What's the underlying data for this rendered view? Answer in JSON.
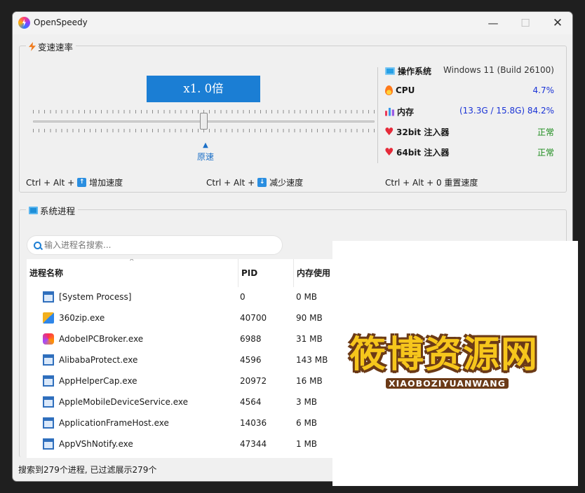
{
  "window": {
    "title": "OpenSpeedy",
    "controls": {
      "minimize": "—",
      "maximize": "☐",
      "close": "✕"
    }
  },
  "speed": {
    "group_title": "变速速率",
    "display": "x1. 0倍",
    "slider_value": 1.0,
    "reset_label": "原速",
    "shortcuts": {
      "increase_combo": "Ctrl + Alt +",
      "increase_key": "↑",
      "increase_label": "增加速度",
      "decrease_combo": "Ctrl + Alt +",
      "decrease_key": "↓",
      "decrease_label": "减少速度",
      "reset_text": "Ctrl + Alt + 0 重置速度"
    }
  },
  "sysinfo": {
    "os_label": "操作系统",
    "os_value": "Windows 11 (Build 26100)",
    "cpu_label": "CPU",
    "cpu_value": "4.7%",
    "mem_label": "内存",
    "mem_value": "(13.3G / 15.8G) 84.2%",
    "inj32_label": "32bit 注入器",
    "inj32_value": "正常",
    "inj64_label": "64bit 注入器",
    "inj64_value": "正常",
    "colors": {
      "value_blue": "#1a33d6",
      "ok_green": "#1a8a1a",
      "accent": "#1b7ed4"
    }
  },
  "processes": {
    "group_title": "系统进程",
    "search_placeholder": "输入进程名搜索...",
    "sort_indicator": "^",
    "columns": {
      "name": "进程名称",
      "pid": "PID",
      "mem": "内存使用"
    },
    "rows": [
      {
        "name": "[System Process]",
        "pid": "0",
        "mem": "0 MB",
        "icon": "window-icon"
      },
      {
        "name": "360zip.exe",
        "pid": "40700",
        "mem": "90 MB",
        "icon": "zip-icon"
      },
      {
        "name": "AdobeIPCBroker.exe",
        "pid": "6988",
        "mem": "31 MB",
        "icon": "adobe-icon"
      },
      {
        "name": "AlibabaProtect.exe",
        "pid": "4596",
        "mem": "143 MB",
        "icon": "window-icon"
      },
      {
        "name": "AppHelperCap.exe",
        "pid": "20972",
        "mem": "16 MB",
        "icon": "window-icon"
      },
      {
        "name": "AppleMobileDeviceService.exe",
        "pid": "4564",
        "mem": "3 MB",
        "icon": "window-icon"
      },
      {
        "name": "ApplicationFrameHost.exe",
        "pid": "14036",
        "mem": "6 MB",
        "icon": "window-icon"
      },
      {
        "name": "AppVShNotify.exe",
        "pid": "47344",
        "mem": "1 MB",
        "icon": "window-icon"
      }
    ]
  },
  "status_bar": {
    "text": "搜索到279个进程, 已过滤展示279个"
  },
  "watermark": {
    "title": "筱博资源网",
    "subtitle": "XIAOBOZIYUANWANG"
  }
}
